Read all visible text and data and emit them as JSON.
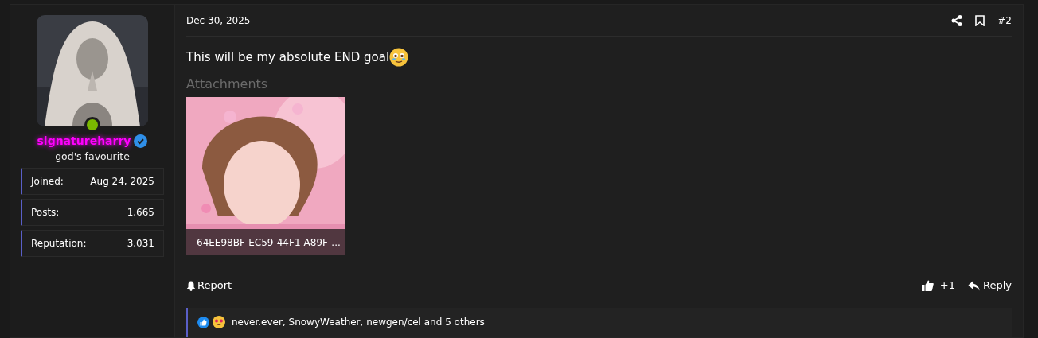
{
  "user": {
    "online": true,
    "name": "signatureharry",
    "verified": true,
    "title": "god's favourite",
    "stats": [
      {
        "label": "Joined:",
        "value": "Aug 24, 2025"
      },
      {
        "label": "Posts:",
        "value": "1,665"
      },
      {
        "label": "Reputation:",
        "value": "3,031"
      }
    ]
  },
  "post": {
    "date": "Dec 30, 2025",
    "number": "#2",
    "message": "This will be my absolute END goal",
    "attachments_title": "Attachments",
    "attachments": [
      {
        "kind": "picture",
        "filename": "64EE98BF-EC59-44F1-A89F-..."
      }
    ]
  },
  "actions": {
    "report": "Report",
    "like_count": "+1",
    "reply": "Reply"
  },
  "reactions": {
    "text": "never.ever, SnowyWeather, newgen/cel and 5 others"
  }
}
